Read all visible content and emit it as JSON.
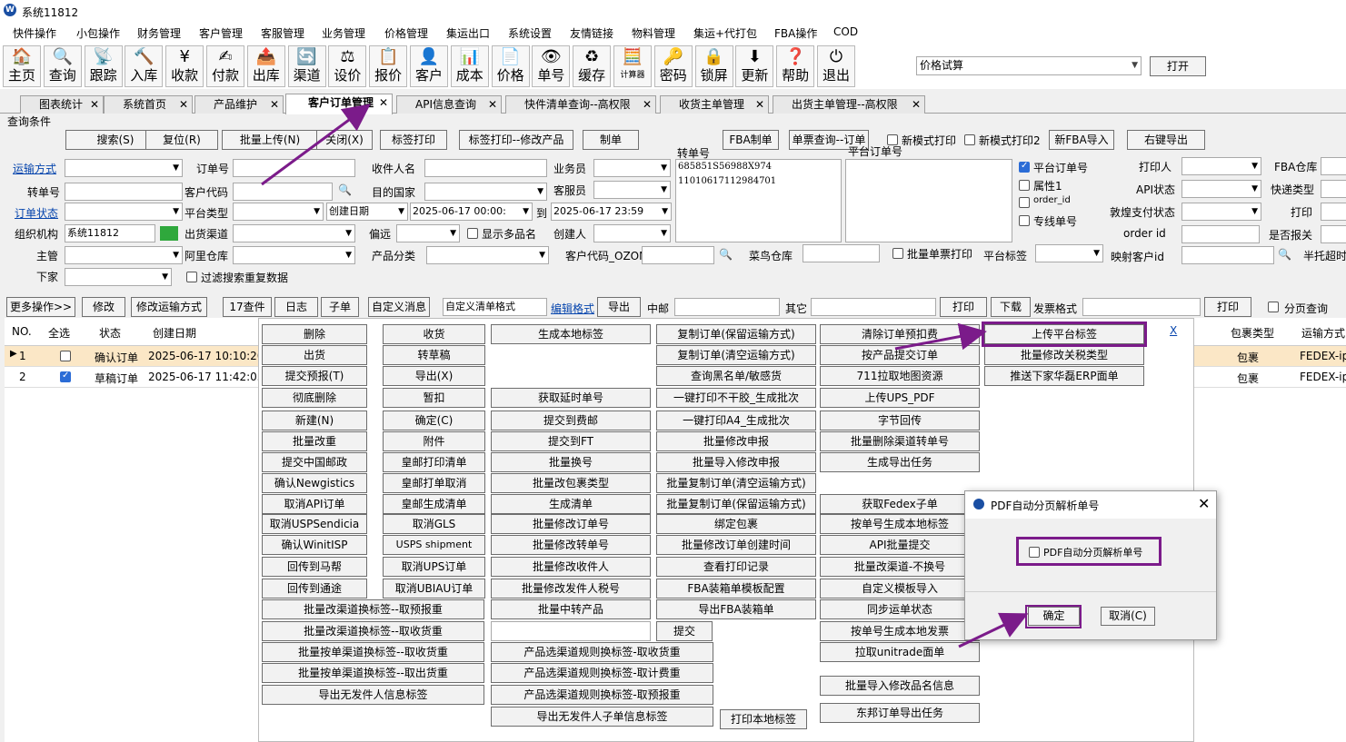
{
  "window": {
    "title": "系统11812",
    "logo": "W"
  },
  "menu": [
    "快件操作",
    "小包操作",
    "财务管理",
    "客户管理",
    "客服管理",
    "业务管理",
    "价格管理",
    "集运出口",
    "系统设置",
    "友情链接",
    "物料管理",
    "集运+代打包",
    "FBA操作",
    "COD"
  ],
  "toolbar": [
    {
      "label": "主页",
      "icon": "home-icon",
      "glyph": "🏠"
    },
    {
      "label": "查询",
      "icon": "search-icon",
      "glyph": "🔍"
    },
    {
      "label": "跟踪",
      "icon": "wifi-icon",
      "glyph": "📡"
    },
    {
      "label": "入库",
      "icon": "hammer-icon",
      "glyph": "🔨"
    },
    {
      "label": "收款",
      "icon": "yen-icon",
      "glyph": "¥"
    },
    {
      "label": "付款",
      "icon": "pay-icon",
      "glyph": "✍"
    },
    {
      "label": "出库",
      "icon": "outbox-icon",
      "glyph": "📤"
    },
    {
      "label": "渠道",
      "icon": "channel-icon",
      "glyph": "🔄"
    },
    {
      "label": "设价",
      "icon": "scale-icon",
      "glyph": "⚖"
    },
    {
      "label": "报价",
      "icon": "quote-icon",
      "glyph": "📋"
    },
    {
      "label": "客户",
      "icon": "user-icon",
      "glyph": "👤"
    },
    {
      "label": "成本",
      "icon": "cost-icon",
      "glyph": "📊"
    },
    {
      "label": "价格",
      "icon": "price-icon",
      "glyph": "📄"
    },
    {
      "label": "单号",
      "icon": "eye-icon",
      "glyph": "👁"
    },
    {
      "label": "缓存",
      "icon": "refresh-icon",
      "glyph": "♻"
    },
    {
      "label": "计算器",
      "icon": "calculator-icon",
      "glyph": "🧮"
    },
    {
      "label": "密码",
      "icon": "key-icon",
      "glyph": "🔑"
    },
    {
      "label": "锁屏",
      "icon": "lock-icon",
      "glyph": "🔒"
    },
    {
      "label": "更新",
      "icon": "download-icon",
      "glyph": "⬇"
    },
    {
      "label": "帮助",
      "icon": "help-icon",
      "glyph": "❓"
    },
    {
      "label": "退出",
      "icon": "power-icon",
      "glyph": "⏻"
    }
  ],
  "top_right": {
    "select_value": "价格试算",
    "open_label": "打开"
  },
  "tabs": [
    {
      "label": "图表统计"
    },
    {
      "label": "系统首页"
    },
    {
      "label": "产品维护"
    },
    {
      "label": "客户订单管理",
      "active": true
    },
    {
      "label": "API信息查询"
    },
    {
      "label": "快件清单查询--高权限"
    },
    {
      "label": "收货主单管理"
    },
    {
      "label": "出货主单管理--高权限"
    }
  ],
  "query": {
    "section_title": "查询条件",
    "buttons": [
      "搜索(S)",
      "复位(R)",
      "批量上传(N)",
      "关闭(X)",
      "标签打印",
      "标签打印--修改产品",
      "制单",
      "FBA制单",
      "单票查询--订单",
      "新FBA导入",
      "右键导出"
    ],
    "new_mode_print": "新模式打印",
    "new_mode_print2": "新模式打印2",
    "labels": {
      "transport": "运输方式",
      "tracking": "转单号",
      "order_status": "订单状态",
      "org": "组织机构",
      "owner": "主管",
      "downstream": "下家",
      "order_no": "订单号",
      "cust_code": "客户代码",
      "platform_type": "平台类型",
      "channel": "出货渠道",
      "ali_wh": "阿里仓库",
      "receiver": "收件人名",
      "dest_country": "目的国家",
      "remote": "偏远",
      "prod_category": "产品分类",
      "salesman": "业务员",
      "cs": "客服员",
      "creator": "创建人",
      "to": "到",
      "show_multi": "显示多品名",
      "filter_dup": "过滤搜索重复数据",
      "cust_code_ozon": "客户代码_OZON",
      "cainiao": "菜鸟仓库",
      "batch_print": "批量单票打印",
      "platform_label": "平台标签",
      "map_cust": "映射客户id",
      "half_hosted": "半托超时",
      "tracking_box": "转单号",
      "platform_order": "平台订单号",
      "printer": "打印人",
      "fba_wh": "FBA仓库",
      "api_status": "API状态",
      "express_type": "快递类型",
      "dh_pay": "敦煌支付状态",
      "print": "打印",
      "order_id": "order id",
      "declare": "是否报关"
    },
    "org_value": "系统11812",
    "date_field": "创建日期",
    "date_from": "2025-06-17 00:00:",
    "date_to": "2025-06-17 23:59",
    "tracking_list": [
      "685851S56988X974",
      "11010617112984701"
    ],
    "check_options": [
      {
        "label": "平台订单号",
        "checked": true
      },
      {
        "label": "属性1",
        "checked": false
      },
      {
        "label": "order_id",
        "checked": false
      },
      {
        "label": "专线单号",
        "checked": false
      }
    ]
  },
  "action_bar": {
    "more": "更多操作>>",
    "edit": "修改",
    "edit_transport": "修改运输方式",
    "count": "17查件",
    "log": "日志",
    "child": "子单",
    "custom_msg": "自定义消息",
    "custom_format": "自定义清单格式",
    "edit_format": "编辑格式",
    "export": "导出",
    "zhongyou": "中邮",
    "other": "其它",
    "print": "打印",
    "download": "下载",
    "invoice_format": "发票格式",
    "print2": "打印",
    "paged_query": "分页查询"
  },
  "grid": {
    "headers": [
      "NO.",
      "全选",
      "状态",
      "创建日期"
    ],
    "right_headers": [
      "包裹类型",
      "运输方式"
    ],
    "rows": [
      {
        "no": "1",
        "checked": false,
        "status": "确认订单",
        "date": "2025-06-17 10:10:20",
        "pkg": "包裹",
        "transport": "FEDEX-ip"
      },
      {
        "no": "2",
        "checked": true,
        "status": "草稿订单",
        "date": "2025-06-17 11:42:05",
        "pkg": "包裹",
        "transport": "FEDEX-ip"
      }
    ]
  },
  "popup": {
    "close": "X",
    "col1": [
      "删除",
      "出货",
      "提交预报(T)",
      "彻底删除",
      "新建(N)",
      "批量改重",
      "提交中国邮政",
      "确认Newgistics",
      "取消API订单",
      "取消USPSendicia",
      "确认WinitISP",
      "回传到马帮",
      "回传到通途"
    ],
    "col2": [
      "收货",
      "转草稿",
      "导出(X)",
      "暂扣",
      "确定(C)",
      "附件",
      "皇邮打印清单",
      "皇邮打单取消",
      "皇邮生成清单",
      "取消GLS",
      "USPS shipment",
      "取消UPS订单",
      "取消UBIAU订单"
    ],
    "col3": [
      "生成本地标签",
      "获取延时单号",
      "提交到费邮",
      "提交到FT",
      "批量换号",
      "批量改包裹类型",
      "生成清单",
      "批量修改订单号",
      "批量修改转单号",
      "批量修改收件人",
      "批量修改发件人税号",
      "批量中转产品"
    ],
    "col4": [
      "复制订单(保留运输方式)",
      "复制订单(清空运输方式)",
      "查询黑名单/敏感货",
      "一键打印不干胶_生成批次",
      "一键打印A4_生成批次",
      "批量修改申报",
      "批量导入修改申报",
      "批量复制订单(清空运输方式)",
      "批量复制订单(保留运输方式)",
      "绑定包裹",
      "批量修改订单创建时间",
      "查看打印记录",
      "FBA装箱单模板配置",
      "导出FBA装箱单"
    ],
    "col5": [
      "清除订单预扣费",
      "按产品提交订单",
      "711拉取地图资源",
      "上传UPS_PDF",
      "字节回传",
      "批量删除渠道转单号",
      "生成导出任务",
      "获取Fedex子单",
      "按单号生成本地标签",
      "API批量提交",
      "批量改渠道-不换号",
      "自定义模板导入",
      "同步运单状态",
      "按单号生成本地发票",
      "拉取unitrade面单",
      "批量导入修改品名信息",
      "东邦订单导出任务"
    ],
    "col6": [
      "上传平台标签",
      "批量修改关税类型",
      "推送下家华磊ERP面单"
    ],
    "wide1": [
      "批量改渠道换标签--取预报重",
      "批量改渠道换标签--取收货重",
      "批量按单渠道换标签--取收货重",
      "批量按单渠道换标签--取出货重",
      "导出无发件人信息标签"
    ],
    "wide2": [
      "产品选渠道规则换标签-取收货重",
      "产品选渠道规则换标签-取计费重",
      "产品选渠道规则换标签-取预报重",
      "导出无发件人子单信息标签"
    ],
    "submit": "提交",
    "print_local": "打印本地标签"
  },
  "dialog": {
    "title": "PDF自动分页解析单号",
    "checkbox": "PDF自动分页解析单号",
    "ok": "确定",
    "cancel": "取消(C)"
  },
  "colors": {
    "highlight": "#7b1b8a",
    "row_selected": "#fbe7c6",
    "link": "#0645ad"
  }
}
